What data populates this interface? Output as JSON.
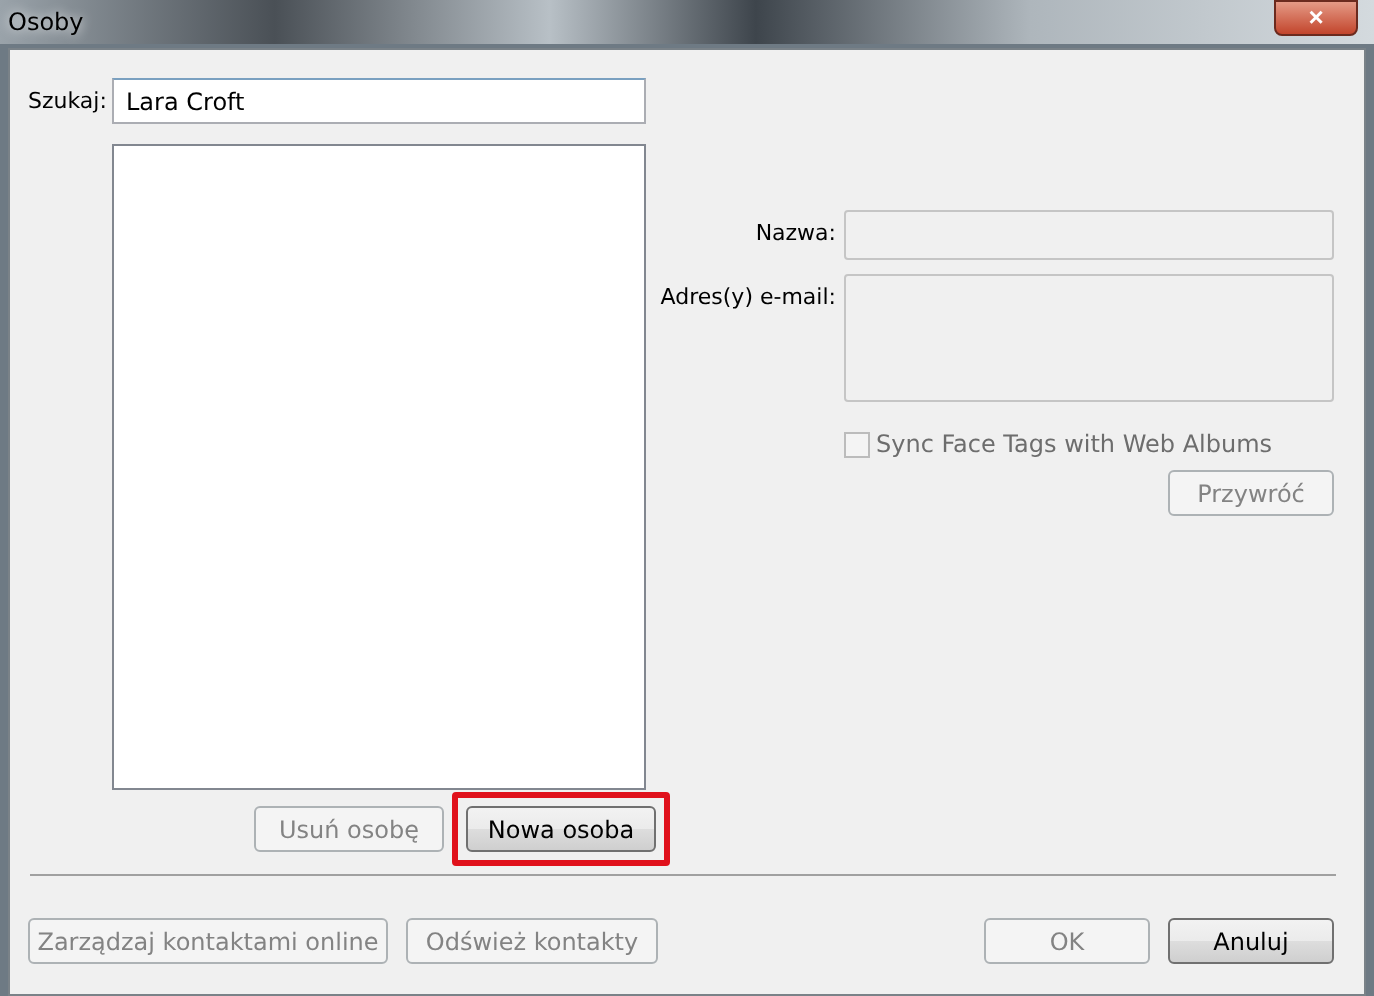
{
  "window": {
    "title": "Osoby",
    "close": "×"
  },
  "search": {
    "label": "Szukaj:",
    "value": "Lara Croft"
  },
  "left_buttons": [
    {
      "label": "Usuń osobę",
      "disabled": true,
      "highlighted": false
    },
    {
      "label": "Nowa osoba",
      "disabled": false,
      "highlighted": true
    }
  ],
  "details": {
    "name_label": "Nazwa:",
    "email_label": "Adres(y) e-mail:",
    "sync": {
      "label": "Sync Face Tags with Web Albums",
      "checked": false,
      "disabled": true
    },
    "restore": {
      "label": "Przywróć",
      "disabled": true
    }
  },
  "footer_buttons": [
    {
      "label": "Zarządzaj kontaktami online",
      "disabled": true,
      "highlighted": false
    },
    {
      "label": "Odśwież kontakty",
      "disabled": true,
      "highlighted": false
    }
  ],
  "dialog_buttons": [
    {
      "label": "OK",
      "disabled": true,
      "highlighted": false
    },
    {
      "label": "Anuluj",
      "disabled": false,
      "highlighted": false
    }
  ]
}
